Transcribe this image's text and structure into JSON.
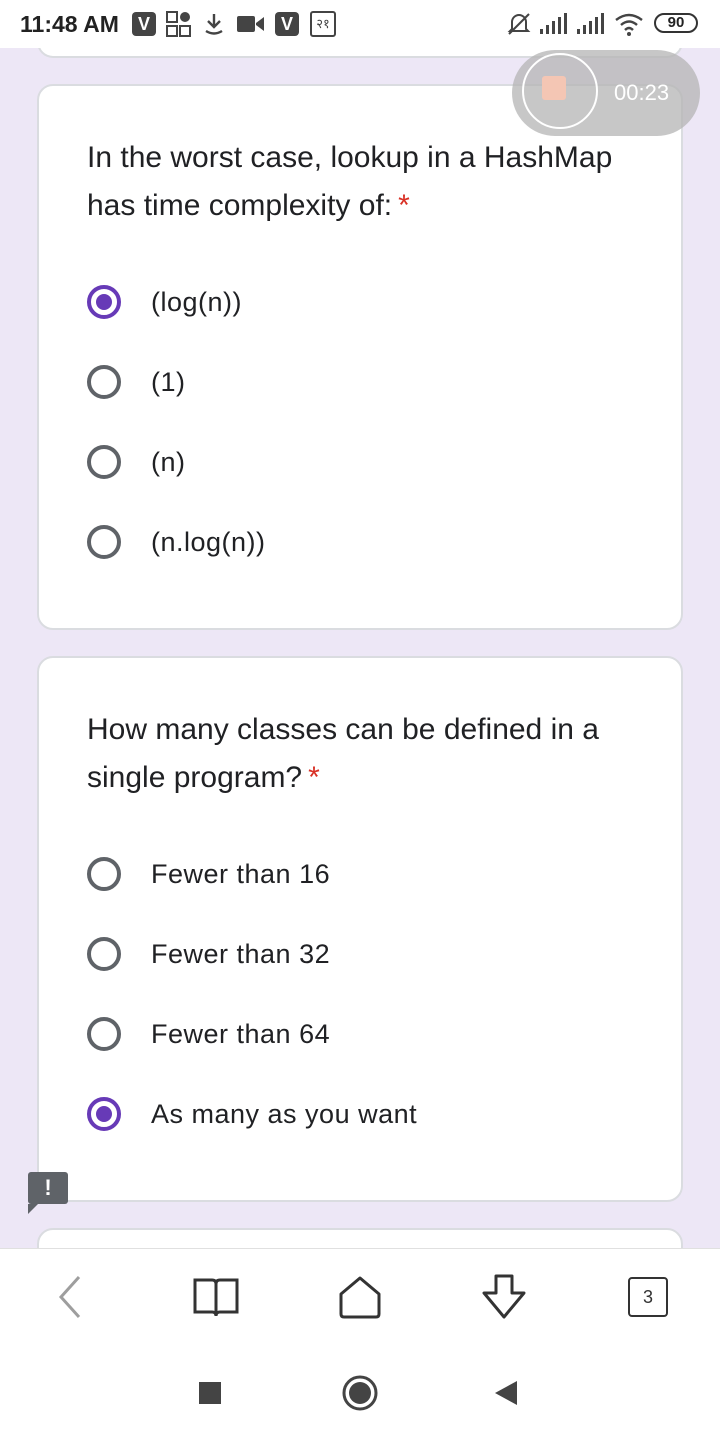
{
  "status_bar": {
    "time": "11:48 AM",
    "v_badge": "V",
    "rupee_label": "२१",
    "battery": "90"
  },
  "recorder": {
    "elapsed": "00:23"
  },
  "questions": [
    {
      "text": "In the worst case, lookup in a HashMap has time complexity of:",
      "required_mark": "*",
      "options": [
        {
          "label": "(log(n))",
          "selected": true
        },
        {
          "label": "(1)",
          "selected": false
        },
        {
          "label": "(n)",
          "selected": false
        },
        {
          "label": "(n.log(n))",
          "selected": false
        }
      ]
    },
    {
      "text": "How many classes can be defined in a single program?",
      "required_mark": "*",
      "options": [
        {
          "label": "Fewer than 16",
          "selected": false
        },
        {
          "label": "Fewer than 32",
          "selected": false
        },
        {
          "label": "Fewer than 64",
          "selected": false
        },
        {
          "label": "As many as you want",
          "selected": true
        }
      ]
    }
  ],
  "feedback": {
    "label": "!"
  },
  "toolbar": {
    "tab_count": "3",
    "icons": [
      "back-icon",
      "bookmarks-icon",
      "home-icon",
      "download-icon",
      "tabs-icon"
    ]
  },
  "nav": {
    "icons": [
      "recents-icon",
      "home-icon",
      "back-icon"
    ]
  },
  "colors": {
    "accent": "#673ab7",
    "background": "#ede7f6",
    "required": "#d93025"
  }
}
